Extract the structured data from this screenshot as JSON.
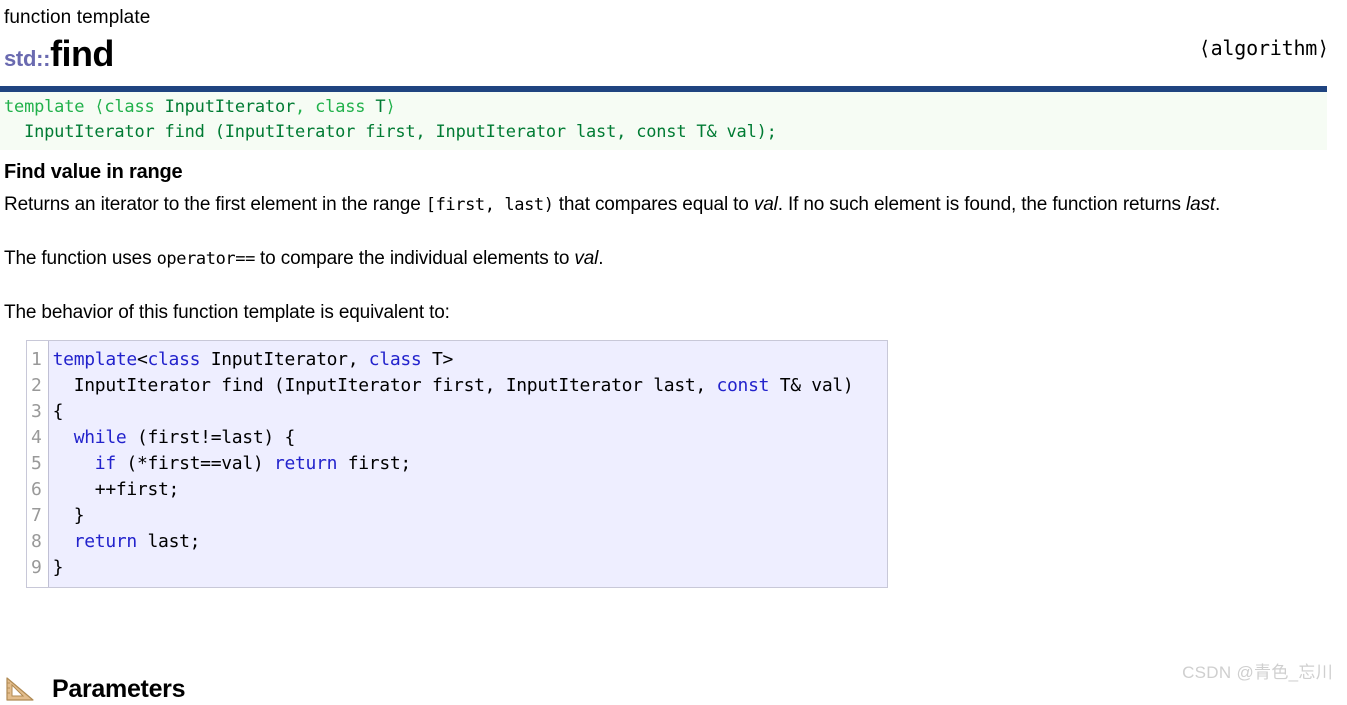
{
  "header": {
    "kind_label": "function template",
    "namespace": "std::",
    "name": "find",
    "include_header": "⟨algorithm⟩"
  },
  "signature": {
    "line1_kw1": "template",
    "line1_open": " ⟨",
    "line1_kw2": "class",
    "line1_type1": " InputIterator",
    "line1_comma": ", ",
    "line1_kw3": "class",
    "line1_type2": " T",
    "line1_close": "⟩",
    "line2": "  InputIterator find (InputIterator first, InputIterator last, const T& val);",
    "full_text": "template <class InputIterator, class T>\n  InputIterator find (InputIterator first, InputIterator last, const T& val);"
  },
  "body": {
    "heading": "Find value in range",
    "para1_a": "Returns an iterator to the first element in the range ",
    "para1_mono": "[first, last)",
    "para1_b": " that compares equal to ",
    "para1_ital": "val",
    "para1_c": ". If no such element is found, the function returns ",
    "para1_ital2": "last",
    "para1_d": ".",
    "para2_a": "The function uses ",
    "para2_mono": "operator==",
    "para2_b": " to compare the individual elements to ",
    "para2_ital": "val",
    "para2_c": ".",
    "para3": "The behavior of this function template is equivalent to:"
  },
  "code_block": {
    "line_numbers": "1\n2\n3\n4\n5\n6\n7\n8\n9",
    "lines": [
      "template<class InputIterator, class T>",
      "  InputIterator find (InputIterator first, InputIterator last, const T& val)",
      "{",
      "  while (first!=last) {",
      "    if (*first==val) return first;",
      "    ++first;",
      "  }",
      "  return last;",
      "}"
    ],
    "keywords": [
      "template",
      "class",
      "while",
      "if",
      "return",
      "const"
    ],
    "keyword_color": "#2222cc",
    "background_color": "#eeeeff",
    "gutter_color": "#999999"
  },
  "parameters_section": {
    "icon": "set-square-ruler-icon",
    "title": "Parameters"
  },
  "watermark": {
    "text": "CSDN @青色_忘川"
  },
  "colors": {
    "namespace_purple": "#6a6ab0",
    "signature_bar_navy": "#1f4480",
    "signature_bg_green": "#f6fcf4",
    "signature_text_green": "#007f3d",
    "signature_keyword_green": "#21b14b",
    "code_keyword_blue": "#2222cc",
    "code_bg_lavender": "#eeeeff",
    "ruler_tan": "#d9ae79",
    "watermark_grey": "#cfcfcf"
  }
}
